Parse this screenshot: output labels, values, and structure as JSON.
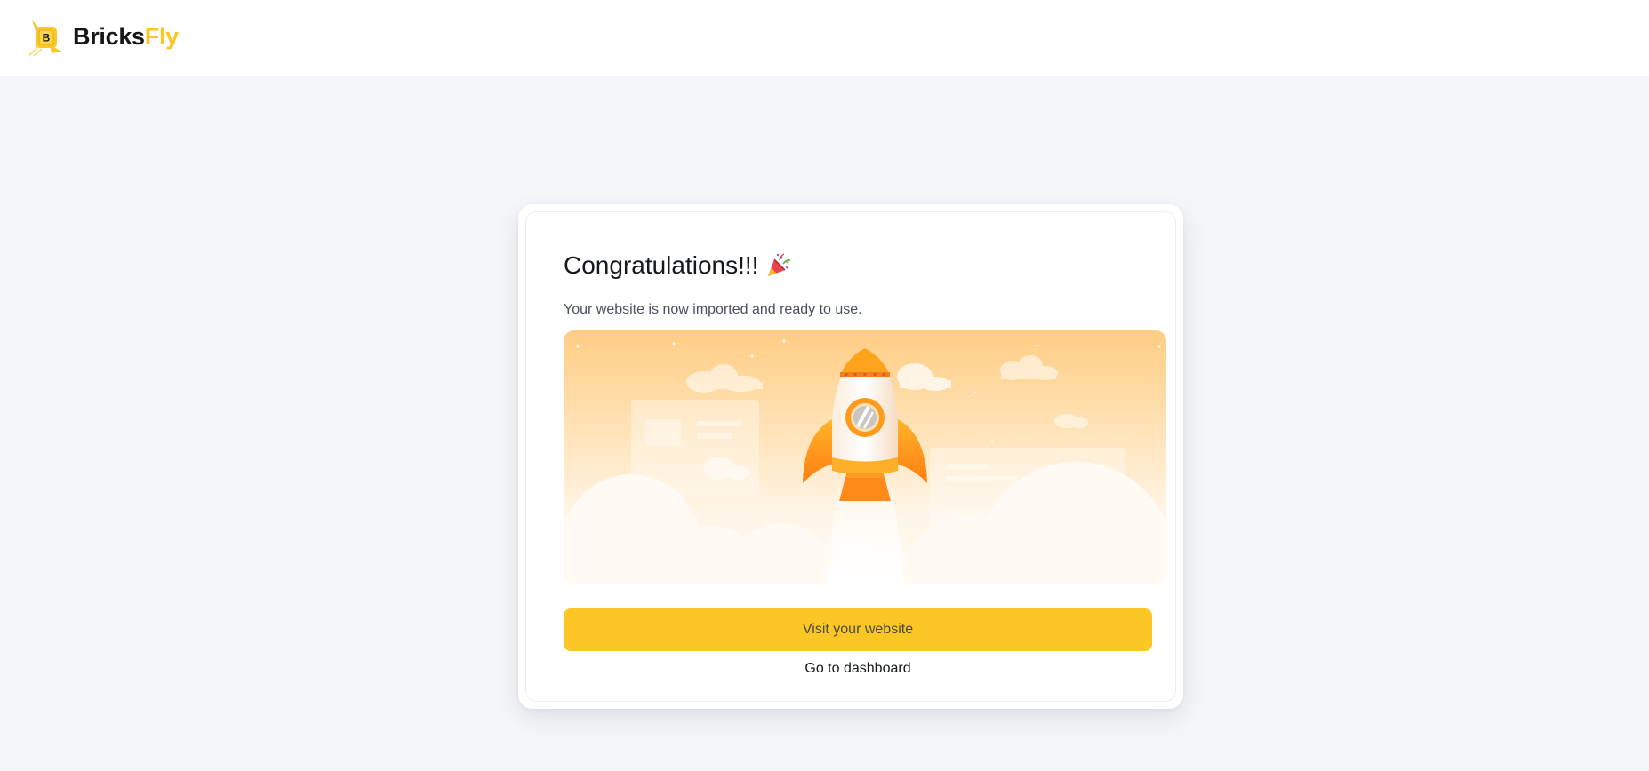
{
  "brand": {
    "name_primary": "Bricks",
    "name_accent": "Fly",
    "mark_letter": "B",
    "accent_color": "#fcc626"
  },
  "success": {
    "title": "Congratulations!!!",
    "title_icon": "party-popper-icon",
    "subtitle": "Your website is now imported and ready to use.",
    "illustration": "rocket-launch-illustration",
    "primary_action": "Visit your website",
    "secondary_action": "Go to dashboard",
    "primary_color": "#fcc624"
  }
}
